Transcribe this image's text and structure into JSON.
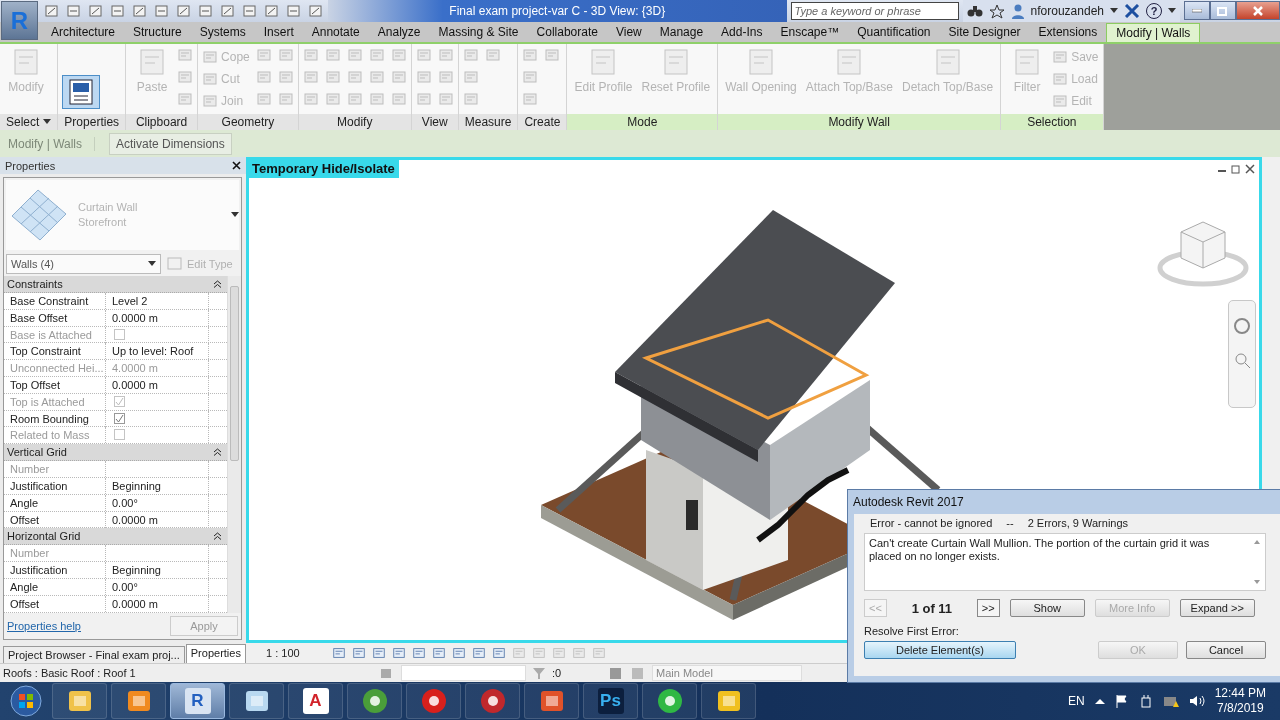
{
  "app_button": {
    "logo": "R"
  },
  "title_bar": {
    "title": "Final exam project-var C - 3D View: {3D}",
    "search": {
      "placeholder": "Type a keyword or phrase"
    },
    "user": "nforouzandeh",
    "help": "?"
  },
  "tabs": [
    {
      "label": "Architecture",
      "selected": false
    },
    {
      "label": "Structure",
      "selected": false
    },
    {
      "label": "Systems",
      "selected": false
    },
    {
      "label": "Insert",
      "selected": false
    },
    {
      "label": "Annotate",
      "selected": false
    },
    {
      "label": "Analyze",
      "selected": false
    },
    {
      "label": "Massing & Site",
      "selected": false
    },
    {
      "label": "Collaborate",
      "selected": false
    },
    {
      "label": "View",
      "selected": false
    },
    {
      "label": "Manage",
      "selected": false
    },
    {
      "label": "Add-Ins",
      "selected": false
    },
    {
      "label": "Enscape™",
      "selected": false
    },
    {
      "label": "Quantification",
      "selected": false
    },
    {
      "label": "Site Designer",
      "selected": false
    },
    {
      "label": "Extensions",
      "selected": false
    },
    {
      "label": "Modify | Walls",
      "selected": true
    }
  ],
  "ribbon": {
    "panels": [
      {
        "title": "Select",
        "contextual": false,
        "dropdown": true,
        "tools": [
          {
            "kind": "large",
            "label": "Modify",
            "disabled": true
          }
        ]
      },
      {
        "title": "Properties",
        "contextual": false,
        "tools": [
          {
            "kind": "toggle",
            "selected": true
          }
        ]
      },
      {
        "title": "Clipboard",
        "contextual": false,
        "tools": [
          {
            "kind": "large",
            "label": "Paste",
            "disabled": true
          },
          {
            "kind": "icon"
          },
          {
            "kind": "icon"
          },
          {
            "kind": "icon"
          }
        ]
      },
      {
        "title": "Geometry",
        "contextual": false,
        "tools": [
          {
            "kind": "small",
            "label": "Cope",
            "disabled": true
          },
          {
            "kind": "small",
            "label": "Cut",
            "disabled": true
          },
          {
            "kind": "small",
            "label": "Join",
            "disabled": true
          },
          {
            "kind": "icon"
          },
          {
            "kind": "icon"
          },
          {
            "kind": "icon"
          },
          {
            "kind": "icon"
          },
          {
            "kind": "icon"
          },
          {
            "kind": "icon"
          }
        ]
      },
      {
        "title": "Modify",
        "contextual": false,
        "tools": [
          {
            "kind": "icon"
          },
          {
            "kind": "icon"
          },
          {
            "kind": "icon"
          },
          {
            "kind": "icon"
          },
          {
            "kind": "icon"
          },
          {
            "kind": "icon"
          },
          {
            "kind": "icon"
          },
          {
            "kind": "icon"
          },
          {
            "kind": "icon"
          },
          {
            "kind": "icon"
          },
          {
            "kind": "icon"
          },
          {
            "kind": "icon"
          },
          {
            "kind": "icon"
          },
          {
            "kind": "icon"
          },
          {
            "kind": "icon"
          }
        ]
      },
      {
        "title": "View",
        "contextual": false,
        "tools": [
          {
            "kind": "icon"
          },
          {
            "kind": "icon"
          },
          {
            "kind": "icon"
          },
          {
            "kind": "icon"
          },
          {
            "kind": "icon"
          },
          {
            "kind": "icon"
          }
        ]
      },
      {
        "title": "Measure",
        "contextual": false,
        "tools": [
          {
            "kind": "icon"
          },
          {
            "kind": "icon"
          },
          {
            "kind": "icon"
          },
          {
            "kind": "icon"
          }
        ]
      },
      {
        "title": "Create",
        "contextual": false,
        "tools": [
          {
            "kind": "icon"
          },
          {
            "kind": "icon"
          },
          {
            "kind": "icon"
          },
          {
            "kind": "icon"
          }
        ]
      },
      {
        "title": "Mode",
        "contextual": true,
        "tools": [
          {
            "kind": "large",
            "label": "Edit Profile",
            "disabled": true
          },
          {
            "kind": "large",
            "label": "Reset Profile",
            "disabled": true
          }
        ]
      },
      {
        "title": "Modify Wall",
        "contextual": true,
        "tools": [
          {
            "kind": "large",
            "label": "Wall Opening",
            "disabled": true
          },
          {
            "kind": "large",
            "label": "Attach Top/Base",
            "disabled": true
          },
          {
            "kind": "large",
            "label": "Detach Top/Base",
            "disabled": true
          }
        ]
      },
      {
        "title": "Selection",
        "contextual": true,
        "tools": [
          {
            "kind": "large",
            "label": "Filter",
            "disabled": true
          },
          {
            "kind": "small",
            "label": "Save",
            "disabled": true
          },
          {
            "kind": "small",
            "label": "Load",
            "disabled": true
          },
          {
            "kind": "small",
            "label": "Edit",
            "disabled": true
          }
        ]
      }
    ]
  },
  "options_bar": {
    "context": "Modify | Walls",
    "button": "Activate Dimensions"
  },
  "properties": {
    "title": "Properties",
    "type_family": "Curtain Wall",
    "type_name": "Storefront",
    "selector": "Walls (4)",
    "edit_type": "Edit Type",
    "groups": [
      {
        "title": "Constraints",
        "rows": [
          {
            "kind": "text",
            "label": "Base Constraint",
            "value": "Level 2",
            "disabled": false
          },
          {
            "kind": "text",
            "label": "Base Offset",
            "value": "0.0000 m",
            "disabled": false
          },
          {
            "kind": "checkbox",
            "label": "Base is Attached",
            "checked": false,
            "disabled": true
          },
          {
            "kind": "text",
            "label": "Top Constraint",
            "value": "Up to level: Roof",
            "disabled": false
          },
          {
            "kind": "text",
            "label": "Unconnected Hei...",
            "value": "4.0000 m",
            "disabled": true
          },
          {
            "kind": "text",
            "label": "Top Offset",
            "value": "0.0000 m",
            "disabled": false
          },
          {
            "kind": "checkbox",
            "label": "Top is Attached",
            "checked": true,
            "disabled": true
          },
          {
            "kind": "checkbox",
            "label": "Room Bounding",
            "checked": true,
            "disabled": false
          },
          {
            "kind": "checkbox",
            "label": "Related to Mass",
            "checked": false,
            "disabled": true
          }
        ]
      },
      {
        "title": "Vertical Grid",
        "rows": [
          {
            "kind": "text",
            "label": "Number",
            "disabled": true
          },
          {
            "kind": "text",
            "label": "Justification",
            "value": "Beginning",
            "disabled": false
          },
          {
            "kind": "text",
            "label": "Angle",
            "value": "0.00°",
            "disabled": false
          },
          {
            "kind": "text",
            "label": "Offset",
            "value": "0.0000 m",
            "disabled": false
          }
        ]
      },
      {
        "title": "Horizontal Grid",
        "rows": [
          {
            "kind": "text",
            "label": "Number",
            "disabled": true
          },
          {
            "kind": "text",
            "label": "Justification",
            "value": "Beginning",
            "disabled": false
          },
          {
            "kind": "text",
            "label": "Angle",
            "value": "0.00°",
            "disabled": false
          },
          {
            "kind": "text",
            "label": "Offset",
            "value": "0.0000 m",
            "disabled": false
          }
        ]
      }
    ],
    "help": "Properties help",
    "apply": "Apply"
  },
  "browser_tabs": [
    {
      "label": "Project Browser - Final exam proj...",
      "selected": false
    },
    {
      "label": "Properties",
      "selected": true
    }
  ],
  "view": {
    "label": "Temporary Hide/Isolate",
    "scale": "1 : 100"
  },
  "dialog": {
    "title": "Autodesk Revit 2017",
    "severity": "Error - cannot be ignored",
    "separator": "--",
    "summary": "2 Errors, 9 Warnings",
    "message": "Can't create Curtain Wall Mullion. The portion of the curtain grid it was placed on no longer exists.",
    "prev": "<<",
    "position": "1 of 11",
    "next": ">>",
    "buttons": [
      {
        "label": "Show",
        "disabled": false
      },
      {
        "label": "More Info",
        "disabled": true
      },
      {
        "label": "Expand >>",
        "disabled": false
      }
    ],
    "resolve_label": "Resolve First Error:",
    "actions": [
      {
        "label": "Delete Element(s)",
        "disabled": false,
        "selected": true
      },
      {
        "label": "OK",
        "disabled": true,
        "selected": false
      },
      {
        "label": "Cancel",
        "disabled": false,
        "selected": false
      }
    ]
  },
  "status_bar": {
    "text": "Roofs : Basic Roof : Roof 1",
    "count": ":0",
    "model": "Main Model"
  },
  "taskbar": {
    "apps": [
      {
        "kind": "explorer",
        "selected": false
      },
      {
        "kind": "media",
        "selected": false
      },
      {
        "kind": "revit",
        "glyph": "R",
        "selected": true
      },
      {
        "kind": "paint",
        "selected": false
      },
      {
        "kind": "acrobat",
        "glyph": "A",
        "selected": false
      },
      {
        "kind": "chrome",
        "selected": false
      },
      {
        "kind": "opera",
        "selected": false
      },
      {
        "kind": "rapid",
        "selected": false
      },
      {
        "kind": "office",
        "selected": false
      },
      {
        "kind": "photoshop",
        "glyph": "Ps",
        "selected": false
      },
      {
        "kind": "whatsapp",
        "selected": false
      },
      {
        "kind": "recorder",
        "selected": false
      }
    ],
    "language": "EN",
    "time": "12:44 PM",
    "date": "7/8/2019"
  }
}
